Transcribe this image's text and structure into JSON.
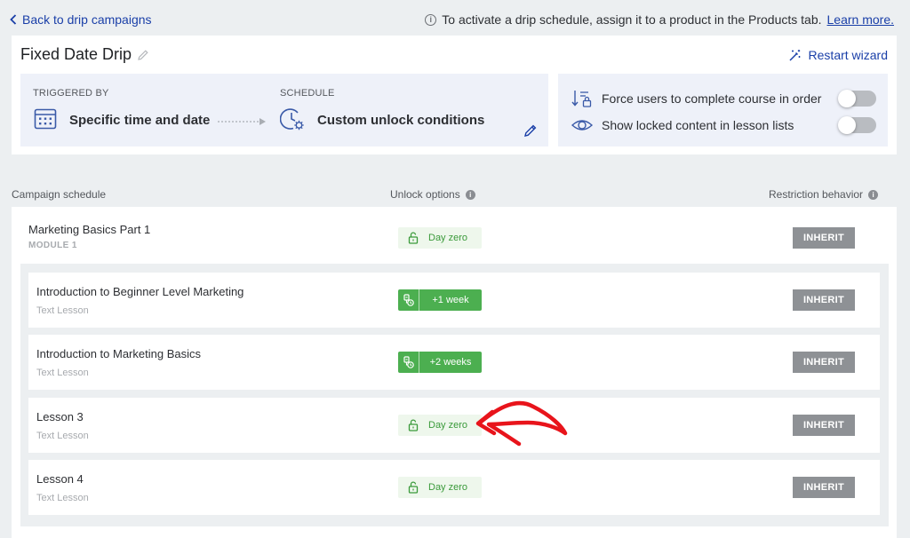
{
  "topbar": {
    "back_label": "Back to drip campaigns",
    "info_text": "To activate a drip schedule, assign it to a product in the Products tab.",
    "learn_more": "Learn more."
  },
  "header": {
    "title": "Fixed Date Drip",
    "restart_label": "Restart wizard",
    "triggered_by_label": "TRIGGERED BY",
    "triggered_by_value": "Specific time and date",
    "schedule_label": "SCHEDULE",
    "schedule_value": "Custom unlock conditions"
  },
  "toggles": [
    {
      "label": "Force users to complete course in order",
      "on": false
    },
    {
      "label": "Show locked content in lesson lists",
      "on": false
    }
  ],
  "columns": {
    "campaign": "Campaign schedule",
    "unlock": "Unlock options",
    "restriction": "Restriction behavior"
  },
  "module": {
    "title": "Marketing Basics Part 1",
    "subtitle": "MODULE 1",
    "unlock": "Day zero",
    "restriction": "INHERIT"
  },
  "lessons": [
    {
      "title": "Introduction to Beginner Level Marketing",
      "type": "Text Lesson",
      "unlock": "+1 week",
      "unlock_style": "delay",
      "restriction": "INHERIT"
    },
    {
      "title": "Introduction to Marketing Basics",
      "type": "Text Lesson",
      "unlock": "+2 weeks",
      "unlock_style": "delay",
      "restriction": "INHERIT"
    },
    {
      "title": "Lesson 3",
      "type": "Text Lesson",
      "unlock": "Day zero",
      "unlock_style": "zero",
      "restriction": "INHERIT"
    },
    {
      "title": "Lesson 4",
      "type": "Text Lesson",
      "unlock": "Day zero",
      "unlock_style": "zero",
      "restriction": "INHERIT"
    }
  ],
  "icons": {
    "back": "chevron-left-icon",
    "info": "info-icon",
    "edit_title": "pencil-icon",
    "restart": "magic-wand-icon",
    "trigger": "calendar-icon",
    "schedule": "clock-gear-icon",
    "edit_schedule": "pencil-icon",
    "force_order": "sort-lock-icon",
    "show_locked": "eye-icon",
    "unlock_zero": "unlock-icon",
    "unlock_delay": "delay-icon"
  },
  "colors": {
    "link": "#1a3fa8",
    "green": "#4caf50",
    "green_light": "#eef7ec",
    "inherit_gray": "#8e9195",
    "annotation_red": "#e8141b"
  }
}
